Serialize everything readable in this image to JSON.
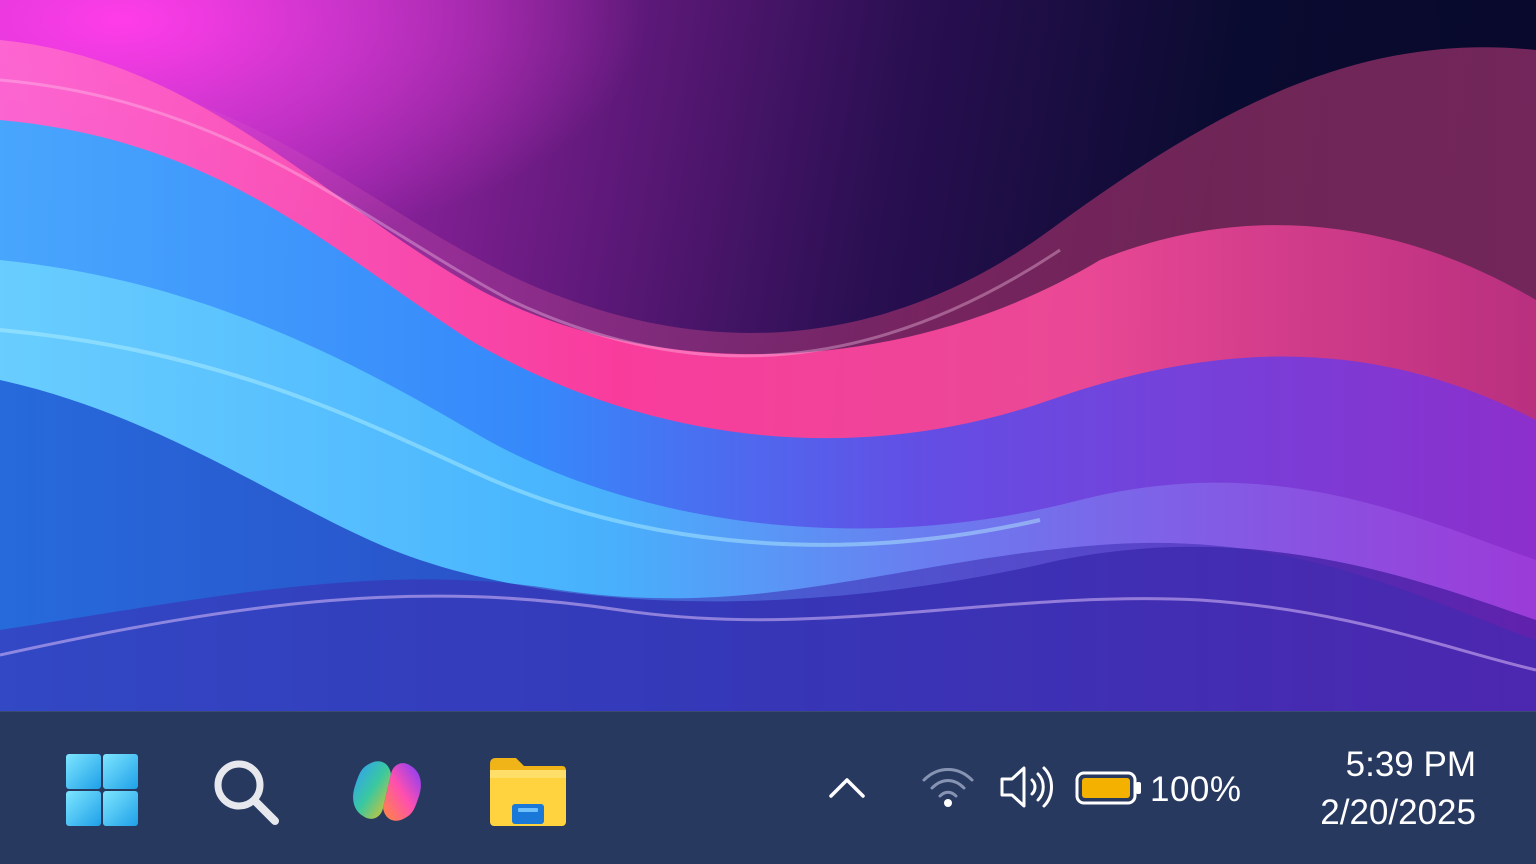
{
  "desktop": {
    "wallpaper": "abstract-waves",
    "colors": {
      "pink": "#ff3db8",
      "blue": "#2f9bff",
      "cyan": "#5fe0ff",
      "violet": "#8b3be0",
      "navy": "#07082a"
    }
  },
  "taskbar": {
    "background": "#283960",
    "pinned": [
      {
        "id": "start",
        "icon": "windows-start-icon"
      },
      {
        "id": "search",
        "icon": "search-icon"
      },
      {
        "id": "copilot",
        "icon": "copilot-icon"
      },
      {
        "id": "file-explorer",
        "icon": "file-explorer-icon"
      }
    ]
  },
  "tray": {
    "overflow_icon": "chevron-up-icon",
    "network_icon": "wifi-icon",
    "volume_icon": "volume-icon",
    "battery_icon": "battery-icon",
    "battery_level": "100%",
    "battery_color": "#f5b100"
  },
  "clock": {
    "time": "5:39 PM",
    "date": "2/20/2025"
  }
}
